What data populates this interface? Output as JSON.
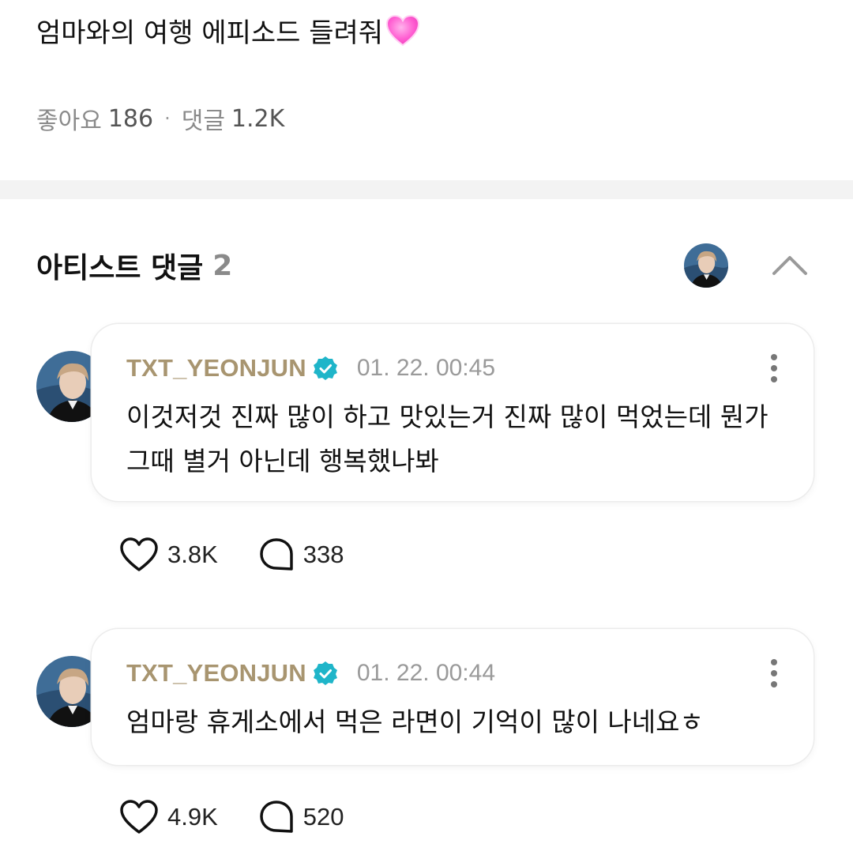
{
  "post": {
    "title": "엄마와의 여행 에피소드 들려줘",
    "likes_label": "좋아요",
    "likes_count": "186",
    "comments_label": "댓글",
    "comments_count": "1.2K"
  },
  "artist_section": {
    "title": "아티스트 댓글",
    "count": "2"
  },
  "comments": [
    {
      "username": "TXT_YEONJUN",
      "time": "01. 22. 00:45",
      "text": "이것저것 진짜 많이 하고 맛있는거 진짜 많이 먹었는데 뭔가 그때 별거 아닌데 행복했나봐",
      "likes": "3.8K",
      "replies": "338"
    },
    {
      "username": "TXT_YEONJUN",
      "time": "01. 22. 00:44",
      "text": "엄마랑 휴게소에서 먹은 라면이 기억이 많이 나네요ㅎ",
      "likes": "4.9K",
      "replies": "520"
    }
  ],
  "colors": {
    "username": "#a89570",
    "verified": "#1fb5c9",
    "muted": "#8a8a8a"
  },
  "icons": [
    "pink-heart-emoji",
    "verified-icon",
    "more-icon",
    "heart-icon",
    "reply-icon",
    "chevron-up-icon",
    "avatar"
  ]
}
